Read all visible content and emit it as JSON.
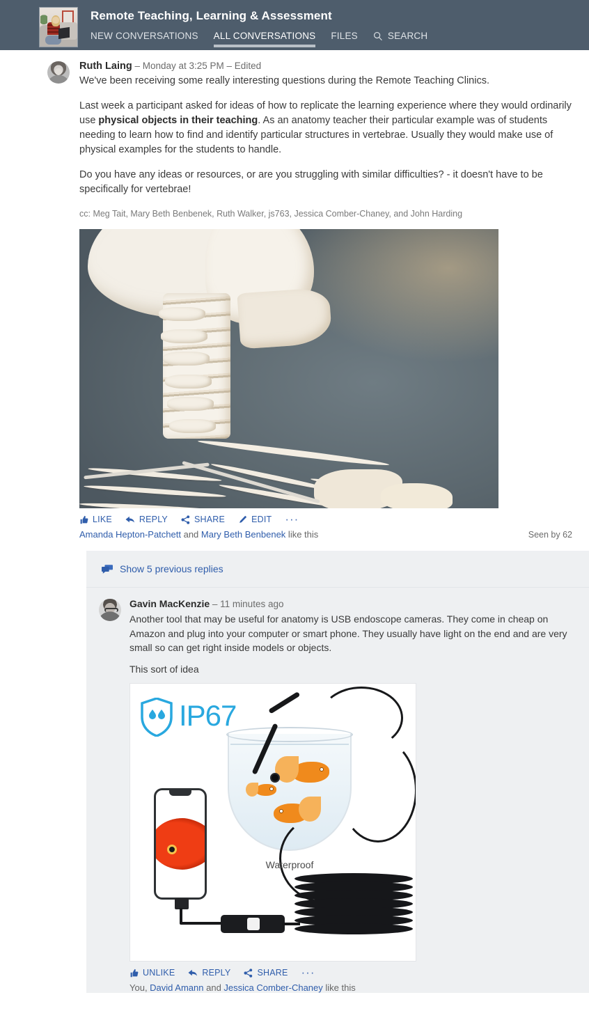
{
  "header": {
    "group_title": "Remote Teaching, Learning & Assessment",
    "group_avatar_alt": "woman-with-laptop-on-couch",
    "nav": [
      {
        "label": "NEW CONVERSATIONS",
        "active": false
      },
      {
        "label": "ALL CONVERSATIONS",
        "active": true
      },
      {
        "label": "FILES",
        "active": false
      },
      {
        "label": "SEARCH",
        "active": false,
        "icon": "search-icon"
      }
    ],
    "colors": {
      "bar": "#4e5d6c",
      "active_underline": "#b9c0c7",
      "text": "#ffffff"
    }
  },
  "post": {
    "author": "Ruth Laing",
    "meta_suffix": " – Monday at 3:25 PM – Edited",
    "avatar_alt": "ruth-laing-portrait-grayscale",
    "paragraph_1": "We've been receiving some really interesting questions during the Remote Teaching Clinics.",
    "paragraph_2_part_1": "Last week a participant asked for ideas of how to replicate the learning experience where they would ordinarily use ",
    "paragraph_2_bold": "physical objects in their teaching",
    "paragraph_2_part_2": ". As an anatomy teacher their particular example was of students needing to learn how to find and identify particular structures in vertebrae. Usually they would make use of physical examples for the students to handle.",
    "paragraph_3": "Do you have any ideas or resources, or are you struggling with similar difficulties? - it doesn't have to be specifically for vertebrae!",
    "cc_line": "cc: Meg Tait, Mary Beth Benbenek, Ruth Walker, js763, Jessica Comber-Chaney, and John Harding",
    "attachment_alt": "skeleton-model-cervical-vertebrae-photo",
    "actions": [
      {
        "label": "LIKE",
        "icon": "thumbs-up-icon"
      },
      {
        "label": "REPLY",
        "icon": "reply-arrow-icon"
      },
      {
        "label": "SHARE",
        "icon": "share-icon"
      },
      {
        "label": "EDIT",
        "icon": "pencil-icon"
      },
      {
        "label": "···",
        "icon": "more-options-icon"
      }
    ],
    "likers_1": "Amanda Hepton-Patchett",
    "likers_join": " and ",
    "likers_2": "Mary Beth Benbenek",
    "likers_suffix": " like this",
    "seen_by": "Seen by 62"
  },
  "replies": {
    "show_previous": "Show 5 previous replies",
    "show_previous_icon": "comments-icon",
    "items": [
      {
        "author": "Gavin MacKenzie",
        "meta_suffix": " – 11 minutes ago",
        "avatar_alt": "gavin-mackenzie-portrait-grayscale",
        "paragraph_1": "Another tool that may be useful for anatomy is USB endoscope cameras. They come in cheap on Amazon and plug into your computer or smart phone. They usually have light on the end and are very small so can get right inside models or objects.",
        "paragraph_2": "This sort of idea",
        "attachment_alt": "ip67-waterproof-usb-endoscope-camera-product-image",
        "attachment_text": {
          "rating_label": "IP67",
          "caption": "Waterproof"
        },
        "actions": [
          {
            "label": "UNLIKE",
            "icon": "thumbs-up-icon"
          },
          {
            "label": "REPLY",
            "icon": "reply-arrow-icon"
          },
          {
            "label": "SHARE",
            "icon": "share-icon"
          },
          {
            "label": "···",
            "icon": "more-options-icon"
          }
        ],
        "likers_prefix": "You, ",
        "likers_1": "David Amann",
        "likers_join": " and ",
        "likers_2": "Jessica Comber-Chaney",
        "likers_suffix": " like this"
      }
    ]
  },
  "colors": {
    "link": "#2f5dab",
    "body_text": "#3a3a3a",
    "muted": "#6b6b6b",
    "reply_bg": "#eef0f2",
    "accent_blue": "#29a8df"
  }
}
